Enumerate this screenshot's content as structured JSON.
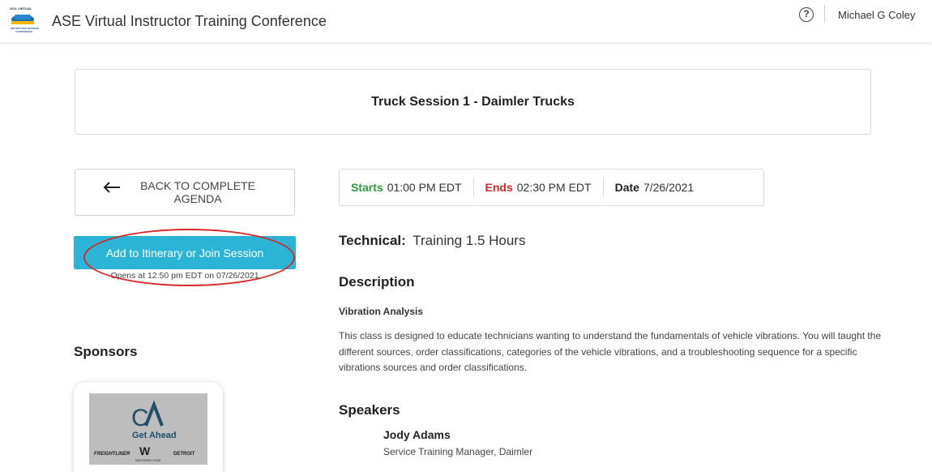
{
  "header": {
    "title": "ASE Virtual Instructor Training Conference",
    "help_icon": "question-circle-icon",
    "help_glyph": "?",
    "user_name": "Michael G Coley",
    "logo_text": "2021 VIRTUAL INSTRUCTOR TRAINING CONFERENCE"
  },
  "session": {
    "title": "Truck Session 1 - Daimler Trucks"
  },
  "sidebar": {
    "back_label": "BACK TO COMPLETE AGENDA",
    "join_label": "Add to Itinerary or Join Session",
    "opens_text": "Opens at 12:50 pm EDT on 07/26/2021",
    "sponsors_heading": "Sponsors",
    "sponsor_logo_words": [
      "Get Ahead",
      "FREIGHTLINER",
      "WESTERN STAR",
      "DETROIT"
    ]
  },
  "times": {
    "starts_label": "Starts",
    "starts_value": "01:00 PM EDT",
    "ends_label": "Ends",
    "ends_value": "02:30 PM EDT",
    "date_label": "Date",
    "date_value": "7/26/2021"
  },
  "technical": {
    "label": "Technical:",
    "value": "Training 1.5 Hours"
  },
  "description": {
    "heading": "Description",
    "subtitle": "Vibration Analysis",
    "body": "This class is designed to educate technicians wanting to understand the fundamentals of vehicle vibrations. You will taught the different sources, order classifications, categories of the vehicle vibrations, and a troubleshooting sequence for a specific vibrations sources and order classifications."
  },
  "speakers": {
    "heading": "Speakers",
    "items": [
      {
        "name": "Jody Adams",
        "role": "Service Training Manager, Daimler"
      }
    ]
  },
  "colors": {
    "accent": "#2bb4d6",
    "starts": "#2a9d3a",
    "ends": "#d62828",
    "annotation": "#d62828"
  }
}
